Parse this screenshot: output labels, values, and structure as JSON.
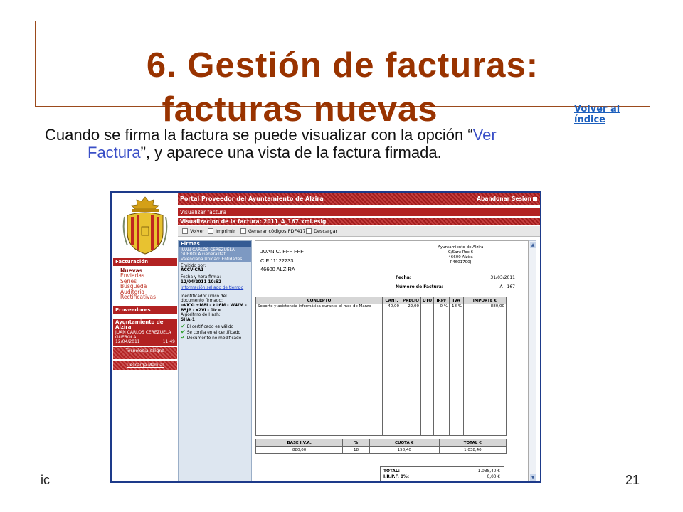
{
  "slide": {
    "title_line1": "6. Gestión de facturas:",
    "title_line2": "facturas nuevas",
    "back_link": "Volver al índice",
    "intro_a": "Cuando se firma la factura se puede visualizar con la opción “",
    "intro_hl1": "Ver",
    "intro_hl2": "Factura",
    "intro_b": "”, y aparece una vista de la factura firmada.",
    "footer_left": "ic",
    "page_number": "21"
  },
  "app": {
    "header": "Portal Proveedor del Ayuntamiento de Alzira",
    "logout": "Abandonar Sesión",
    "section": "Visualizar factura",
    "doc_title": "Visualizacion de la factura: 2011_A_167.xml.esig",
    "toolbar": [
      "Volver",
      "Imprimir",
      "Generar códigos PDF417",
      "Descargar"
    ],
    "sidebar": {
      "facturacion": "Facturación",
      "items": [
        "Nuevas",
        "Enviadas",
        "Series",
        "Búsqueda",
        "Auditoría",
        "Rectificativas"
      ],
      "proveedores": "Proveedores",
      "user_org": "Ayuntamiento de Alzira",
      "user_name": "JUAN CARLOS CEREZUELA GUEROLA",
      "date": "12/04/2011",
      "time": "11:49",
      "esigne": "Tecnologia eSigne",
      "manual": "Descarga Manual"
    },
    "firmas": {
      "title": "Firmas",
      "signer": "JUAN CARLOS CEREZUELA GUEROLA Generalitat Valenciana Unidad: Entidades",
      "emitted_label": "Emitido por:",
      "emitted_value": "ACCV-CA1",
      "datetime_label": "Fecha y hora firma:",
      "datetime_value": "12/04/2011 10:52",
      "timestamp_link": "Información sellado de tiempo",
      "id_label": "Identificador único del documento firmado:",
      "id_value": "uVKX- +M8I - kU6M - W4fM - B5JP - x2Vi - 0lc=",
      "hash_label": "Algoritmo de Hash:",
      "hash_value": "SHA-1",
      "checks": [
        "El certificado es válido",
        "Se confía en el certificado",
        "Documento no modificado"
      ]
    },
    "invoice": {
      "sender": [
        "JUAN C. FFF FFF",
        "CIF 11122233",
        "46600 ALZIRA"
      ],
      "receiver": [
        "Ayuntamiento de Alzira",
        "C/Sant Roc 6",
        "46600 Alzira",
        "P4601700J"
      ],
      "fecha_label": "Fecha:",
      "fecha_value": "31/03/2011",
      "numero_label": "Número de Factura:",
      "numero_value": "A - 167",
      "headers": [
        "CONCEPTO",
        "CANT.",
        "PRECIO",
        "DTO",
        "IRPF",
        "IVA",
        "IMPORTE €"
      ],
      "row": [
        "Soporte y asistencia informática durante el mes de Marzo",
        "40,00",
        "22,00",
        "",
        "0 %",
        "18 %",
        "880,00"
      ],
      "base_headers": [
        "BASE I.V.A.",
        "%",
        "CUOTA €",
        "TOTAL €"
      ],
      "base_row": [
        "880,00",
        "18",
        "158,40",
        "1.038,40"
      ],
      "total_label": "TOTAL:",
      "total_value": "1.038,40 €",
      "irpf_label": "I.R.P.F. 0%:",
      "irpf_value": "0,00 €"
    }
  }
}
